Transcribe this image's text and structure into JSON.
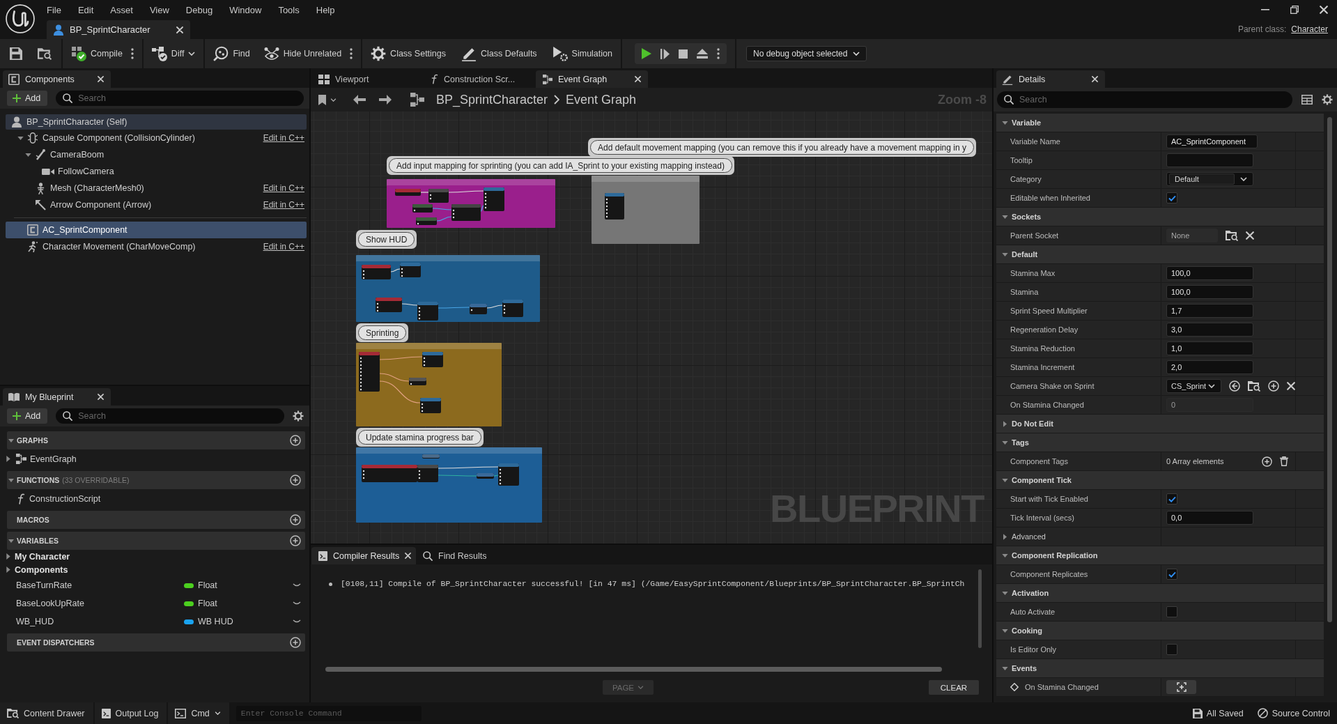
{
  "title_bar": {
    "menu": [
      "File",
      "Edit",
      "Asset",
      "View",
      "Debug",
      "Window",
      "Tools",
      "Help"
    ],
    "document_tabs": [
      {
        "label": "BP_SprintCharacter",
        "selected": true
      }
    ],
    "parent_class": {
      "label": "Parent class:",
      "value": "Character"
    }
  },
  "toolbar": {
    "buttons": [
      {
        "kind": "menu",
        "label": "Compile"
      },
      {
        "kind": "dropdown",
        "label": "Diff"
      },
      {
        "kind": "plain",
        "label": "Find"
      },
      {
        "kind": "menu",
        "label": "Hide Unrelated"
      },
      {
        "kind": "plain",
        "label": "Class Settings"
      },
      {
        "kind": "plain",
        "label": "Class Defaults"
      },
      {
        "kind": "plain",
        "label": "Simulation"
      }
    ],
    "debug_object": {
      "value": "No debug object selected"
    }
  },
  "components": {
    "tab": {
      "label": "Components",
      "selected": true
    },
    "add_button": "Add",
    "search": {
      "placeholder": "Search"
    },
    "tree": [
      {
        "label": "BP_SprintCharacter (Self)",
        "selected": false,
        "children": [
          {
            "label": "Capsule Component (CollisionCylinder)",
            "selected": false,
            "expanded": true,
            "link": "Edit in C++",
            "children": [
              {
                "label": "CameraBoom",
                "selected": false,
                "expanded": true,
                "children": [
                  {
                    "label": "FollowCamera",
                    "selected": false
                  }
                ]
              },
              {
                "label": "Mesh (CharacterMesh0)",
                "selected": false,
                "link": "Edit in C++"
              },
              {
                "label": "Arrow Component (Arrow)",
                "selected": false,
                "link": "Edit in C++"
              }
            ]
          }
        ]
      }
    ],
    "other": [
      {
        "label": "AC_SprintComponent",
        "selected": true
      },
      {
        "label": "Character Movement (CharMoveComp)",
        "selected": false,
        "link": "Edit in C++"
      }
    ]
  },
  "my_blueprint": {
    "tab": {
      "label": "My Blueprint",
      "selected": true
    },
    "add_button": "Add",
    "search": {
      "placeholder": "Search"
    },
    "sections": [
      {
        "title": "GRAPHS",
        "expanded": true,
        "items": [
          {
            "kind": "graph",
            "label": "EventGraph",
            "expanded": false
          }
        ]
      },
      {
        "title": "FUNCTIONS",
        "note": "(33 OVERRIDABLE)",
        "expanded": true,
        "items": [
          {
            "kind": "function",
            "label": "ConstructionScript"
          }
        ]
      },
      {
        "title": "MACROS"
      },
      {
        "title": "VARIABLES",
        "expanded": true,
        "items": [
          {
            "kind": "category",
            "label": "My Character",
            "expanded": false
          },
          {
            "kind": "category",
            "label": "Components",
            "expanded": false
          },
          {
            "kind": "variable",
            "label": "BaseTurnRate",
            "type": "Float",
            "color": "#4ccf1f"
          },
          {
            "kind": "variable",
            "label": "BaseLookUpRate",
            "type": "Float",
            "color": "#4ccf1f"
          },
          {
            "kind": "variable",
            "label": "WB_HUD",
            "type": "WB HUD",
            "color": "#1aa3f0"
          }
        ]
      },
      {
        "title": "EVENT DISPATCHERS"
      }
    ]
  },
  "graph_editor": {
    "tabs": [
      {
        "label": "Viewport",
        "selected": false
      },
      {
        "label": "Construction Scr...",
        "selected": false
      },
      {
        "label": "Event Graph",
        "selected": true
      }
    ],
    "breadcrumb": [
      "BP_SprintCharacter",
      "Event Graph"
    ],
    "zoom": "Zoom -8",
    "comments": [
      {
        "text": "Add input mapping for sprinting (you can add IA_Sprint to your existing mapping instead)",
        "color": "#9a1f8c"
      },
      {
        "text": "Add default movement mapping (you can remove this if you already have a movement mapping in y",
        "color": "#767676"
      },
      {
        "text": "Show HUD",
        "color": "#1e5b8a"
      },
      {
        "text": "Sprinting",
        "color": "#8c6a1e"
      },
      {
        "text": "Update stamina progress bar",
        "color": "#1d5e96"
      }
    ],
    "corner_label": "BLUEPRINT"
  },
  "compiler": {
    "tabs": [
      {
        "label": "Compiler Results",
        "selected": true
      },
      {
        "label": "Find Results",
        "selected": false
      }
    ],
    "messages": [
      "[0108,11] Compile of BP_SprintCharacter successful! [in 47 ms] (/Game/EasySprintComponent/Blueprints/BP_SprintCharacter.BP_SprintCh"
    ],
    "page_button": {
      "label": "PAGE",
      "disabled": true
    },
    "clear_button": "CLEAR"
  },
  "details": {
    "tab": {
      "label": "Details",
      "selected": true
    },
    "search": {
      "placeholder": "Search"
    },
    "sections": [
      {
        "title": "Variable",
        "expanded": true,
        "rows": [
          {
            "kind": "field",
            "label": "Variable Name",
            "value": "AC_SprintComponent"
          },
          {
            "kind": "field",
            "label": "Tooltip"
          },
          {
            "kind": "combo",
            "label": "Category",
            "value": "Default"
          },
          {
            "kind": "check",
            "label": "Editable when Inherited",
            "checked": true
          }
        ]
      },
      {
        "title": "Sockets",
        "expanded": true,
        "rows": [
          {
            "kind": "socket",
            "label": "Parent Socket",
            "value": "None"
          }
        ]
      },
      {
        "title": "Default",
        "expanded": true,
        "rows": [
          {
            "kind": "field",
            "label": "Stamina Max",
            "value": "100,0"
          },
          {
            "kind": "field",
            "label": "Stamina",
            "value": "100,0"
          },
          {
            "kind": "field",
            "label": "Sprint Speed Multiplier",
            "value": "1,7"
          },
          {
            "kind": "field",
            "label": "Regeneration Delay",
            "value": "3,0"
          },
          {
            "kind": "field",
            "label": "Stamina Reduction",
            "value": "1,0"
          },
          {
            "kind": "field",
            "label": "Stamina Increment",
            "value": "2,0"
          },
          {
            "kind": "asset",
            "label": "Camera Shake on Sprint",
            "value": "CS_Sprint"
          },
          {
            "kind": "readonly",
            "label": "On Stamina Changed",
            "value": "0"
          }
        ]
      },
      {
        "title": "Do Not Edit",
        "expanded": false
      },
      {
        "title": "Tags",
        "expanded": true,
        "rows": [
          {
            "kind": "array",
            "label": "Component Tags",
            "value": "0 Array elements"
          }
        ]
      },
      {
        "title": "Component Tick",
        "expanded": true,
        "rows": [
          {
            "kind": "check",
            "label": "Start with Tick Enabled",
            "checked": true
          },
          {
            "kind": "field",
            "label": "Tick Interval (secs)",
            "value": "0,0"
          },
          {
            "kind": "advanced",
            "label": "Advanced",
            "expanded": false
          }
        ]
      },
      {
        "title": "Component Replication",
        "expanded": true,
        "rows": [
          {
            "kind": "check",
            "label": "Component Replicates",
            "checked": true
          }
        ]
      },
      {
        "title": "Activation",
        "expanded": true,
        "rows": [
          {
            "kind": "check",
            "label": "Auto Activate",
            "checked": false
          }
        ]
      },
      {
        "title": "Cooking",
        "expanded": true,
        "rows": [
          {
            "kind": "check",
            "label": "Is Editor Only",
            "checked": false
          }
        ]
      },
      {
        "title": "Events",
        "expanded": true,
        "rows": [
          {
            "kind": "event",
            "label": "On Stamina Changed"
          }
        ]
      }
    ]
  },
  "status_bar": {
    "buttons": [
      {
        "kind": "button",
        "label": "Content Drawer"
      },
      {
        "kind": "button",
        "label": "Output Log"
      },
      {
        "kind": "dropdown",
        "label": "Cmd"
      }
    ],
    "console": {
      "placeholder": "Enter Console Command"
    },
    "indicators": [
      {
        "label": "All Saved"
      },
      {
        "label": "Source Control"
      }
    ]
  }
}
